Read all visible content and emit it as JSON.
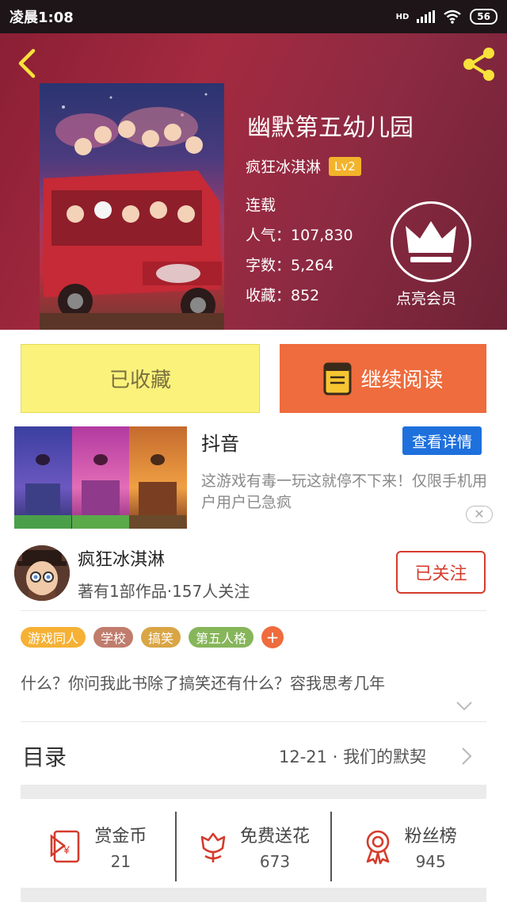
{
  "status_bar": {
    "time": "凌晨1:08",
    "network": "HD",
    "battery": "56"
  },
  "book": {
    "title": "幽默第五幼儿园",
    "author": "疯狂冰淇淋",
    "level": "Lv2",
    "status": "连载",
    "popularity": "人气：107,830",
    "word_count": "字数：5,264",
    "favorites": "收藏：852",
    "vip_label": "点亮会员"
  },
  "actions": {
    "collected": "已收藏",
    "continue_reading": "继续阅读"
  },
  "ad": {
    "name": "抖音",
    "button": "查看详情",
    "desc": "这游戏有毒一玩这就停不下来！仅限手机用户用户已急疯",
    "close": "✕",
    "panel_colors": [
      "#4c4bb3",
      "#d15ca6",
      "#e9923f"
    ]
  },
  "author_card": {
    "name": "疯狂冰淇淋",
    "sub": "著有1部作品·157人关注",
    "follow": "已关注"
  },
  "tags": [
    {
      "label": "游戏同人",
      "color": "#f6b135"
    },
    {
      "label": "学校",
      "color": "#c07c6c"
    },
    {
      "label": "搞笑",
      "color": "#d9a545"
    },
    {
      "label": "第五人格",
      "color": "#86b55a"
    }
  ],
  "tag_add": "+",
  "intro": "什么？你问我此书除了搞笑还有什么？容我思考几年",
  "toc": {
    "label": "目录",
    "latest": "12-21 · 我们的默契"
  },
  "stats": [
    {
      "icon": "red-envelope-icon",
      "label": "赏金币",
      "value": "21"
    },
    {
      "icon": "flower-icon",
      "label": "免费送花",
      "value": "673"
    },
    {
      "icon": "medal-icon",
      "label": "粉丝榜",
      "value": "945"
    }
  ],
  "colors": {
    "accent": "#ee6c3d",
    "hero": "#a42a40",
    "stat_icon": "#d43c2c"
  }
}
